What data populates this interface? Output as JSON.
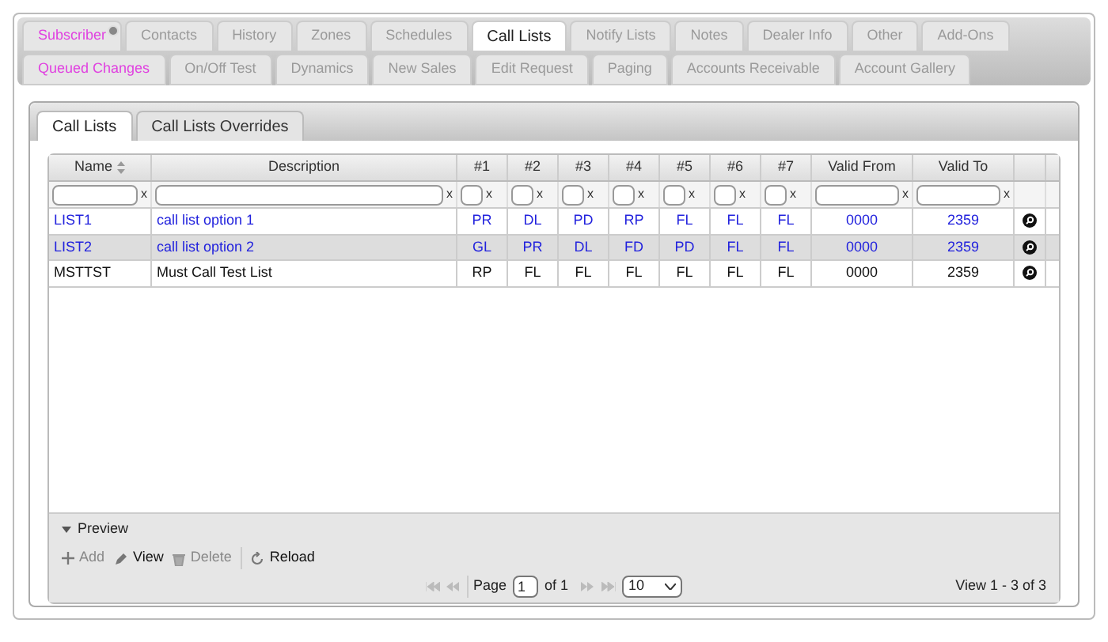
{
  "top_tabs": [
    [
      {
        "label": "Subscriber",
        "selected": false,
        "highlighted": true,
        "badge": true
      },
      {
        "label": "Contacts",
        "selected": false,
        "highlighted": false,
        "badge": false
      },
      {
        "label": "History",
        "selected": false,
        "highlighted": false,
        "badge": false
      },
      {
        "label": "Zones",
        "selected": false,
        "highlighted": false,
        "badge": false
      },
      {
        "label": "Schedules",
        "selected": false,
        "highlighted": false,
        "badge": false
      },
      {
        "label": "Call Lists",
        "selected": true,
        "highlighted": false,
        "badge": false
      },
      {
        "label": "Notify Lists",
        "selected": false,
        "highlighted": false,
        "badge": false
      },
      {
        "label": "Notes",
        "selected": false,
        "highlighted": false,
        "badge": false
      },
      {
        "label": "Dealer Info",
        "selected": false,
        "highlighted": false,
        "badge": false
      },
      {
        "label": "Other",
        "selected": false,
        "highlighted": false,
        "badge": false
      },
      {
        "label": "Add-Ons",
        "selected": false,
        "highlighted": false,
        "badge": false
      }
    ],
    [
      {
        "label": "Queued Changes",
        "selected": false,
        "highlighted": true,
        "badge": false
      },
      {
        "label": "On/Off Test",
        "selected": false,
        "highlighted": false,
        "badge": false
      },
      {
        "label": "Dynamics",
        "selected": false,
        "highlighted": false,
        "badge": false
      },
      {
        "label": "New Sales",
        "selected": false,
        "highlighted": false,
        "badge": false
      },
      {
        "label": "Edit Request",
        "selected": false,
        "highlighted": false,
        "badge": false
      },
      {
        "label": "Paging",
        "selected": false,
        "highlighted": false,
        "badge": false
      },
      {
        "label": "Accounts Receivable",
        "selected": false,
        "highlighted": false,
        "badge": false
      },
      {
        "label": "Account Gallery",
        "selected": false,
        "highlighted": false,
        "badge": false
      }
    ]
  ],
  "inner_tabs": [
    {
      "label": "Call Lists",
      "selected": true
    },
    {
      "label": "Call Lists Overrides",
      "selected": false
    }
  ],
  "table": {
    "columns": [
      {
        "label": "Name",
        "sorted": true,
        "kind": "wide",
        "clear_mark": "x"
      },
      {
        "label": "Description",
        "sorted": false,
        "kind": "wide",
        "clear_mark": "x"
      },
      {
        "label": "#1",
        "sorted": false,
        "kind": "small",
        "clear_mark": "x"
      },
      {
        "label": "#2",
        "sorted": false,
        "kind": "small",
        "clear_mark": "x"
      },
      {
        "label": "#3",
        "sorted": false,
        "kind": "small",
        "clear_mark": "x"
      },
      {
        "label": "#4",
        "sorted": false,
        "kind": "small",
        "clear_mark": "x"
      },
      {
        "label": "#5",
        "sorted": false,
        "kind": "small",
        "clear_mark": "x"
      },
      {
        "label": "#6",
        "sorted": false,
        "kind": "small",
        "clear_mark": "x"
      },
      {
        "label": "#7",
        "sorted": false,
        "kind": "small",
        "clear_mark": "x"
      },
      {
        "label": "Valid From",
        "sorted": false,
        "kind": "wide",
        "clear_mark": "x"
      },
      {
        "label": "Valid To",
        "sorted": false,
        "kind": "wide",
        "clear_mark": "x"
      }
    ],
    "rows": [
      {
        "kind": "link",
        "selected": false,
        "cells": [
          "LIST1",
          "call list option 1",
          "PR",
          "DL",
          "PD",
          "RP",
          "FL",
          "FL",
          "FL",
          "0000",
          "2359"
        ]
      },
      {
        "kind": "link",
        "selected": true,
        "cells": [
          "LIST2",
          "call list option 2",
          "GL",
          "PR",
          "DL",
          "FD",
          "PD",
          "FL",
          "FL",
          "0000",
          "2359"
        ]
      },
      {
        "kind": "plain",
        "selected": false,
        "cells": [
          "MSTTST",
          "Must Call Test List",
          "RP",
          "FL",
          "FL",
          "FL",
          "FL",
          "FL",
          "FL",
          "0000",
          "2359"
        ]
      }
    ]
  },
  "preview": {
    "label": "Preview",
    "expanded": false
  },
  "actions": [
    {
      "kind": "add",
      "label": "Add",
      "disabled": true
    },
    {
      "kind": "view",
      "label": "View",
      "disabled": false
    },
    {
      "kind": "delete",
      "label": "Delete",
      "disabled": true
    },
    {
      "kind": "reload",
      "label": "Reload",
      "disabled": false
    }
  ],
  "pager": {
    "page_label": "Page",
    "page": "1",
    "of_label": "of 1",
    "page_size": "10",
    "summary": "View 1 - 3 of 3"
  }
}
